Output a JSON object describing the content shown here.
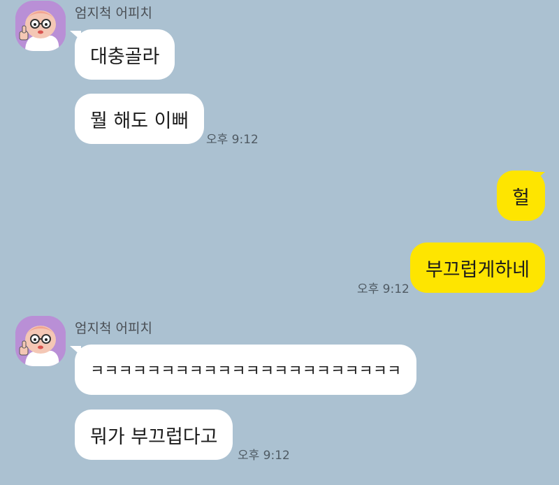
{
  "chat": {
    "blocks": [
      {
        "sender": "엄지척 어피치",
        "messages": [
          "대충골라",
          "뭘 해도 이뻐"
        ],
        "time": "오후 9:12"
      },
      {
        "messages": [
          "헐",
          "부끄럽게하네"
        ],
        "time": "오후 9:12"
      },
      {
        "sender": "엄지척 어피치",
        "messages": [
          "ㅋㅋㅋㅋㅋㅋㅋㅋㅋㅋㅋㅋㅋㅋㅋㅋㅋㅋㅋㅋㅋㅋ",
          "뭐가 부끄럽다고"
        ],
        "time": "오후 9:12"
      }
    ]
  },
  "colors": {
    "background": "#abc1d1",
    "incoming_bubble": "#ffffff",
    "outgoing_bubble": "#fee500",
    "avatar_bg": "#b98fd6"
  },
  "icons": {
    "avatar": "apeach-thumbs-up-avatar-icon"
  }
}
